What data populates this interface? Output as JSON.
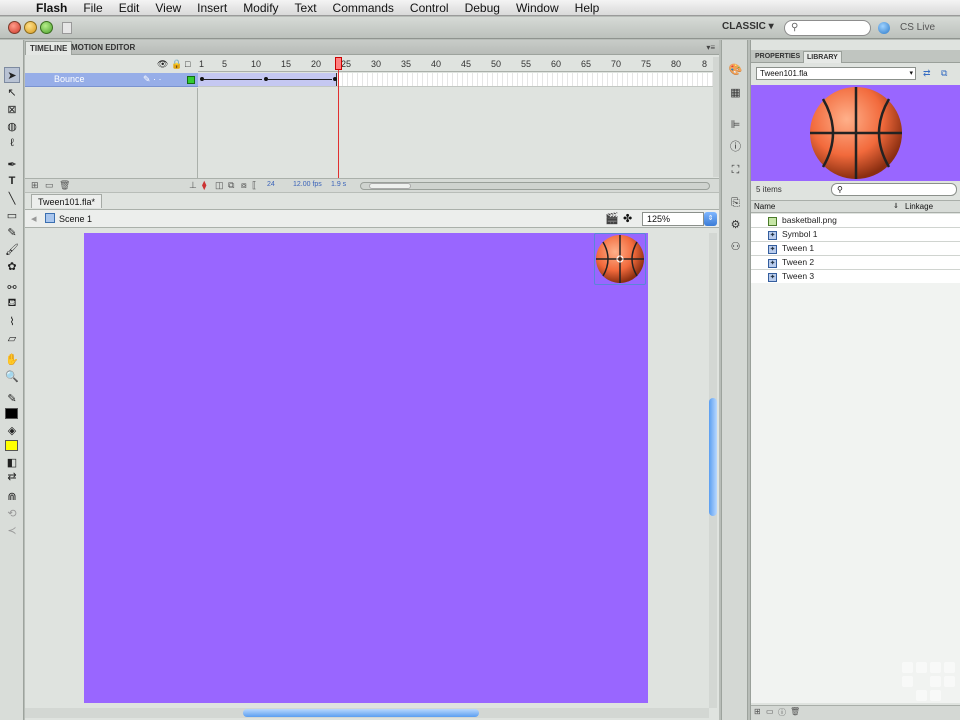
{
  "menubar": {
    "app_name": "Flash",
    "items": [
      "File",
      "Edit",
      "View",
      "Insert",
      "Modify",
      "Text",
      "Commands",
      "Control",
      "Debug",
      "Window",
      "Help"
    ]
  },
  "titlebar": {
    "workspace": "CLASSIC ▾",
    "search_placeholder": "",
    "cs_live": "CS Live"
  },
  "timeline": {
    "tabs": [
      "TIMELINE",
      "MOTION EDITOR"
    ],
    "ruler_ticks": [
      "1",
      "5",
      "10",
      "15",
      "20",
      "25",
      "30",
      "35",
      "40",
      "45",
      "50",
      "55",
      "60",
      "65",
      "70",
      "75",
      "80",
      "8"
    ],
    "layer": {
      "name": "Bounce",
      "color": "#33cc33"
    },
    "current_frame": "24",
    "fps": "12.00 fps",
    "elapsed": "1.9 s"
  },
  "stage": {
    "doc_tab": "Tween101.fla*",
    "scene": "Scene 1",
    "zoom": "125%",
    "background_color": "#9966ff"
  },
  "library": {
    "tabs": [
      "PROPERTIES",
      "LIBRARY"
    ],
    "document": "Tween101.fla",
    "items_count": "5 items",
    "col_name": "Name",
    "col_linkage": "Linkage",
    "items": [
      {
        "label": "basketball.png",
        "type": "bitmap"
      },
      {
        "label": "Symbol 1",
        "type": "graphic"
      },
      {
        "label": "Tween 1",
        "type": "graphic"
      },
      {
        "label": "Tween 2",
        "type": "graphic"
      },
      {
        "label": "Tween 3",
        "type": "graphic"
      }
    ]
  },
  "colors": {
    "accent_blue": "#5b9ef0",
    "stage_purple": "#9966ff",
    "playhead_red": "#e03030"
  }
}
